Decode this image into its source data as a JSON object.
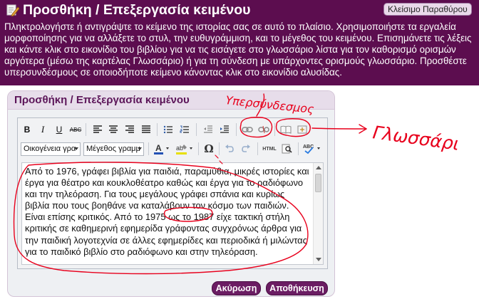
{
  "header": {
    "title": "Προσθήκη / Επεξεργασία κειμένου",
    "close_label": "Κλείσιμο Παραθύρου",
    "instructions": "Πληκτρολογήστε ή αντιγράψτε το κείμενο της ιστορίας σας σε αυτό το πλαίσιο. Χρησιμοποιήστε τα εργαλεία μορφοποίησης για να αλλάξετε το στυλ, την ευθυγράμμιση, και το μέγεθος του κειμένου. Επισημάνετε τις λέξεις και κάντε κλικ στο εικονίδιο του βιβλίου για να τις εισάγετε στο γλωσσάριο λίστα για τον καθορισμό ορισμών αργότερα (μέσω της καρτέλας Γλωσσάριο) ή για τη σύνδεση με υπάρχοντες ορισμούς γλωσσάριο. Προσθέστε υπερσυνδέσμους σε οποιοδήποτε κείμενο κάνοντας κλικ στο εικονίδιο αλυσίδας."
  },
  "dialog": {
    "title": "Προσθήκη / Επεξεργασία κειμένου"
  },
  "toolbar": {
    "bold": "B",
    "italic": "I",
    "underline": "U",
    "strike": "ABC",
    "font_family": "Οικογένεια γρα",
    "font_size": "Μέγεθος γραμμ",
    "html": "HTML"
  },
  "editor_text": "Από το 1976, γράφει βιβλία για παιδιά, παραμύθια, μικρές ιστορίες και έργα για θέατρο και κουκλοθέατρο καθώς και έργα για το ραδιόφωνο και την τηλεόραση. Για τους μεγάλους γράφει σπάνια και κυρίως βιβλία που τους βοηθάνε να καταλάβουν τον κόσμο των παιδιών. Είναι επίσης κριτικός. Από το 1975 ως το 1987 είχε τακτική στήλη κριτικής σε καθημερινή εφημερίδα γράφοντας συγχρόνως άρθρα για την παιδική λογοτεχνία σε άλλες εφημερίδες και περιοδικά ή μιλώντας για το παιδικό βιβλίο στο ραδιόφωνο και στην τηλεόραση.",
  "buttons": {
    "cancel": "Ακύρωση",
    "save": "Αποθήκευση"
  },
  "annotations": {
    "hyperlink": "Υπερσύνδεσμος",
    "glossary": "Γλωσσάρι"
  },
  "colors": {
    "header_bg": "#5c0d4f",
    "button_bg": "#6b1d63",
    "annotation": "#e8001c"
  }
}
